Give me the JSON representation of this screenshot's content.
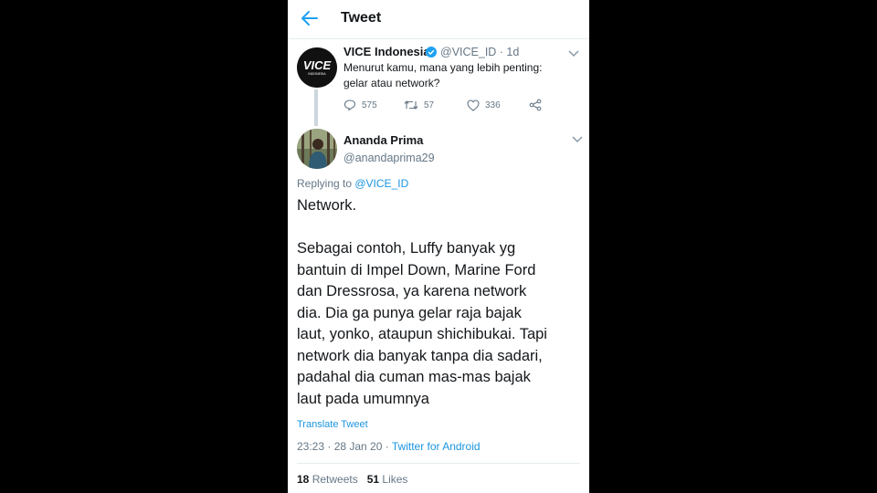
{
  "header": {
    "title": "Tweet",
    "back_icon": "arrow-left-icon",
    "accent": "#1da1f2"
  },
  "original_tweet": {
    "display_name": "VICE Indonesia",
    "handle_time": "@VICE_ID · 1d",
    "avatar_logo_text": "VICE",
    "avatar_logo_subtext": "INDONESIA",
    "text_line1": "Menurut kamu, mana yang lebih penting:",
    "text_line2": "gelar atau network?",
    "replies": "575",
    "retweets": "57",
    "likes": "336"
  },
  "reply_tweet": {
    "display_name": "Ananda Prima",
    "handle": "@anandaprima29",
    "replying_prefix": "Replying to ",
    "replying_to": "@VICE_ID",
    "text": "Network.\n\nSebagai contoh, Luffy banyak yg\nbantuin di Impel Down, Marine Ford\ndan Dressrosa, ya karena network\ndia. Dia ga punya gelar raja bajak\nlaut, yonko, ataupun shichibukai. Tapi\nnetwork dia banyak tanpa dia sadari,\npadahal dia cuman mas-mas bajak\nlaut pada umumnya",
    "translate": "Translate Tweet",
    "timestamp": "23:23 · 28 Jan 20 · ",
    "source": "Twitter for Android",
    "retweet_count": "18",
    "retweets_label": " Retweets   ",
    "like_count": "51",
    "likes_label": " Likes"
  },
  "colors": {
    "link": "#1b95e0",
    "muted": "#657786",
    "text": "#14171a",
    "verified": "#1da1f2"
  }
}
